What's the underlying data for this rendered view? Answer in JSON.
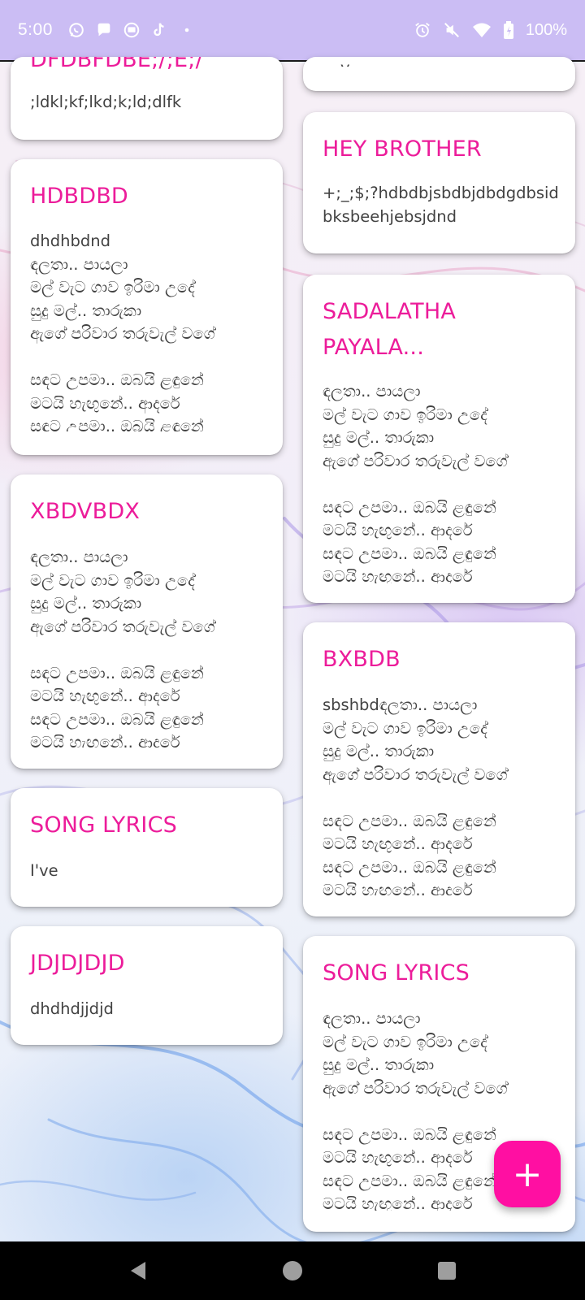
{
  "status_bar": {
    "time": "5:00",
    "left_icons": [
      "whatsapp-icon",
      "chat-icon",
      "mail-icon",
      "tiktok-icon",
      "dot-icon"
    ],
    "right_icons": [
      "alarm-icon",
      "mute-icon",
      "wifi-icon",
      "battery-icon"
    ],
    "battery": "100%"
  },
  "notes": [
    {
      "title": "DFDBFDBE;/;E;/",
      "body": ";ldkl;kf;lkd;k;ld;dlfk"
    },
    {
      "title": "",
      "body": "y"
    },
    {
      "title": "HEY BROTHER",
      "body": "+;_;$;?hdbdbjsbdbjdbdgdbsidbksbeehjebsjdnd"
    },
    {
      "title": "HDBDBD",
      "body": "dhdhbdnd\nඳලතා.. පායලා\nමල් වැට ගාව ඉරිමා උදේ\nසුදු මල්.. තාරුකා\nඇගේ පරිවාර තරුවැල් වගේ\n\nසඳට උපමා.. ඔබයි ළඳුනේ\nමටයි හැඟුනේ.. ආදරේ\nසඳට උපමා.. ඔබයි ළඳුනේ"
    },
    {
      "title": "SADALATHA PAYALA...",
      "body": "ඳලතා.. පායලා\nමල් වැට ගාව ඉරිමා උදේ\nසුදු මල්.. තාරුකා\nඇගේ පරිවාර තරුවැල් වගේ\n\nසඳට උපමා.. ඔබයි ළඳුනේ\nමටයි හැඟුනේ.. ආදරේ\nසඳට උපමා.. ඔබයි ළඳුනේ\nමටයි හැඟුනේ.. ආදරේ"
    },
    {
      "title": "XBDVBDX",
      "body": "ඳලතා.. පායලා\nමල් වැට ගාව ඉරිමා උදේ\nසුදු මල්.. තාරුකා\nඇගේ පරිවාර තරුවැල් වගේ\n\nසඳට උපමා.. ඔබයි ළඳුනේ\nමටයි හැඟුනේ.. ආදරේ\nසඳට උපමා.. ඔබයි ළඳුනේ\nමටයි හැඟුනේ.. ආදරේ"
    },
    {
      "title": "BXBDB",
      "body": "sbshbdඳලතා.. පායලා\nමල් වැට ගාව ඉරිමා උදේ\nසුදු මල්.. තාරුකා\nඇගේ පරිවාර තරුවැල් වගේ\n\nසඳට උපමා.. ඔබයි ළඳුනේ\nමටයි හැඟුනේ.. ආදරේ\nසඳට උපමා.. ඔබයි ළඳුනේ\nමටයි හැඟුනේ.. ආදරේ"
    },
    {
      "title": "SONG LYRICS",
      "body": "I've"
    },
    {
      "title": "JDJDJDJD",
      "body": "dhdhdjjdjd"
    },
    {
      "title": "SONG LYRICS",
      "body": "ඳලතා.. පායලා\nමල් වැට ගාව ඉරිමා උදේ\nසුදු මල්.. තාරුකා\nඇගේ පරිවාර තරුවැල් වගේ\n\nසඳට උපමා.. ඔබයි ළඳුනේ\nමටයි හැඟුනේ.. ආදරේ\nසඳට උපමා.. ඔබයි ළඳුනේ\nමටයි හැඟුනේ.. ආදරේ"
    }
  ],
  "fab": {
    "symbol": "+",
    "icon": "add-icon"
  },
  "nav": {
    "icons": [
      "back-icon",
      "home-icon",
      "recents-icon"
    ]
  },
  "colors": {
    "status_bar": "#cbbdf4",
    "title": "#ec1c9a",
    "body_text": "#424242",
    "fab": "#ff0fa2",
    "card": "#ffffff"
  }
}
